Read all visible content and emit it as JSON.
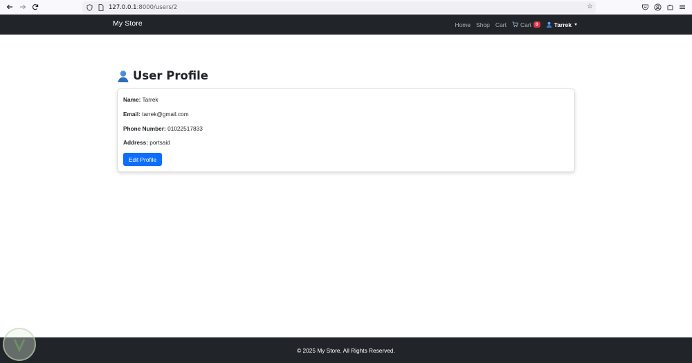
{
  "browser": {
    "url_host": "127.0.0.1",
    "url_rest": ":8000/users/2"
  },
  "navbar": {
    "brand": "My Store",
    "links": [
      "Home",
      "Shop",
      "Cart"
    ],
    "cart_label": "Cart",
    "cart_count": "0",
    "user_name": "Tarrek"
  },
  "profile": {
    "title": "User Profile",
    "name_label": "Name:",
    "name_value": "Tarrek",
    "email_label": "Email:",
    "email_value": "tarrek@gmail.com",
    "phone_label": "Phone Number:",
    "phone_value": "01022517833",
    "address_label": "Address:",
    "address_value": "portsaid",
    "edit_button": "Edit Profile"
  },
  "footer": {
    "text": "© 2025 My Store. All Rights Reserved."
  },
  "colors": {
    "navbar_bg": "#212529",
    "primary": "#0d6efd",
    "badge": "#dc3545"
  }
}
